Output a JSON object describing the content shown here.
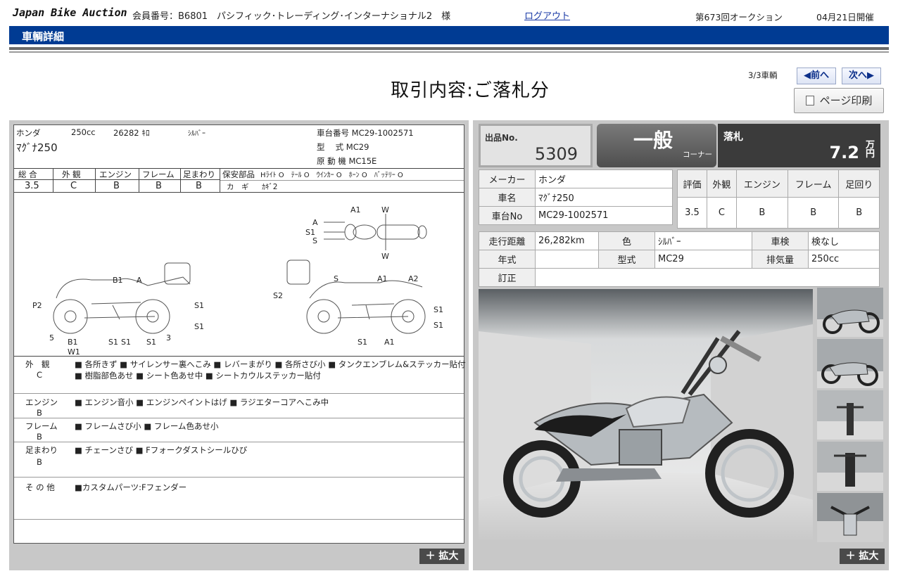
{
  "header": {
    "logo": "Japan Bike Auction",
    "member_label": "会員番号：B6801　パシフィック･トレーディング･インターナショナル2　様",
    "logout": "ログアウト",
    "auction_round": "第673回オークション",
    "auction_date": "04月21日開催"
  },
  "band_title": "車輌詳細",
  "page_title": "取引内容:ご落札分",
  "pager": {
    "count": "3/3車輌",
    "prev": "◀前へ",
    "next": "次へ▶",
    "print": "ページ印刷"
  },
  "sheet": {
    "maker": "ホンダ",
    "cc": "250cc",
    "mileage": "26282 ｷﾛ",
    "color": "ｼﾙﾊﾞｰ",
    "model_name": "ﾏｸﾞﾅ250",
    "frame_no": "車台番号 MC29-1002571",
    "model_code": "型　 式 MC29",
    "engine_code": "原 動 機 MC15E",
    "grade_headers": [
      "総 合",
      "外 観",
      "エンジン",
      "フレーム",
      "足まわり"
    ],
    "grade_values": [
      "3.5",
      "C",
      "B",
      "B",
      "B"
    ],
    "safety_label": "保安部品",
    "safety_items": "Hﾗｲﾄ O　ﾃｰﾙ O　ｳｲﾝｶｰ O　ﾎｰﾝ O　ﾊﾞｯﾃﾘｰ O",
    "key_label": "カ　ギ",
    "key_value": "ｶｷﾞ2",
    "diagram_top_labels": [
      "A1",
      "W",
      "A",
      "S1",
      "S",
      "W"
    ],
    "diagram_left_labels": [
      "B1",
      "A",
      "P2",
      "S1",
      "S1",
      "5",
      "B1",
      "W1",
      "S1",
      "S1",
      "S1",
      "3"
    ],
    "diagram_right_labels": [
      "S",
      "A1",
      "A2",
      "S2",
      "S1",
      "S1",
      "S1",
      "A1"
    ],
    "notes": [
      {
        "label": "外　観",
        "grade": "C",
        "line1": "■ 各所きず ■ サイレンサー裏へこみ ■ レバーまがり ■ 各所さび小 ■ タンクエンブレム&ステッカー貼付",
        "line2": "■ 樹脂部色あせ ■ シート色あせ中 ■ シートカウルステッカー貼付"
      },
      {
        "label": "エンジン",
        "grade": "B",
        "line1": "■ エンジン音小 ■ エンジンペイントはげ ■ ラジエターコアへこみ中",
        "line2": ""
      },
      {
        "label": "フレーム",
        "grade": "B",
        "line1": "■ フレームさび小 ■ フレーム色あせ小",
        "line2": ""
      },
      {
        "label": "足まわり",
        "grade": "B",
        "line1": "■ チェーンさび ■ Fフォークダストシールひび",
        "line2": ""
      },
      {
        "label": "そ の 他",
        "grade": "",
        "line1": "■カスタムパーツ:Fフェンダー",
        "line2": ""
      }
    ],
    "zoom": "＋ 拡大"
  },
  "lot": {
    "label": "出品No.",
    "number": "5309",
    "corner_big": "一般",
    "corner_small": "コーナー",
    "sold_label": "落札",
    "price": "7.2",
    "unit_top": "万",
    "unit_bottom": "円"
  },
  "info": {
    "maker_label": "メーカー",
    "maker": "ホンダ",
    "name_label": "車名",
    "name": "ﾏｸﾞﾅ250",
    "frame_label": "車台No",
    "frame": "MC29-1002571",
    "grade_headers": [
      "評価",
      "外観",
      "エンジン",
      "フレーム",
      "足回り"
    ],
    "grade_values": [
      "3.5",
      "C",
      "B",
      "B",
      "B"
    ],
    "mileage_label": "走行距離",
    "mileage": "26,282km",
    "color_label": "色",
    "color": "ｼﾙﾊﾞｰ",
    "inspection_label": "車検",
    "inspection": "検なし",
    "year_label": "年式",
    "year": "",
    "type_label": "型式",
    "type": "MC29",
    "displacement_label": "排気量",
    "displacement": "250cc",
    "correction_label": "訂正",
    "correction": ""
  },
  "photos": {
    "zoom": "＋ 拡大",
    "thumb_count": 5
  },
  "colors": {
    "band": "#003b93",
    "panel": "#c8c8c8",
    "sold_bg": "#3b3b3b"
  }
}
